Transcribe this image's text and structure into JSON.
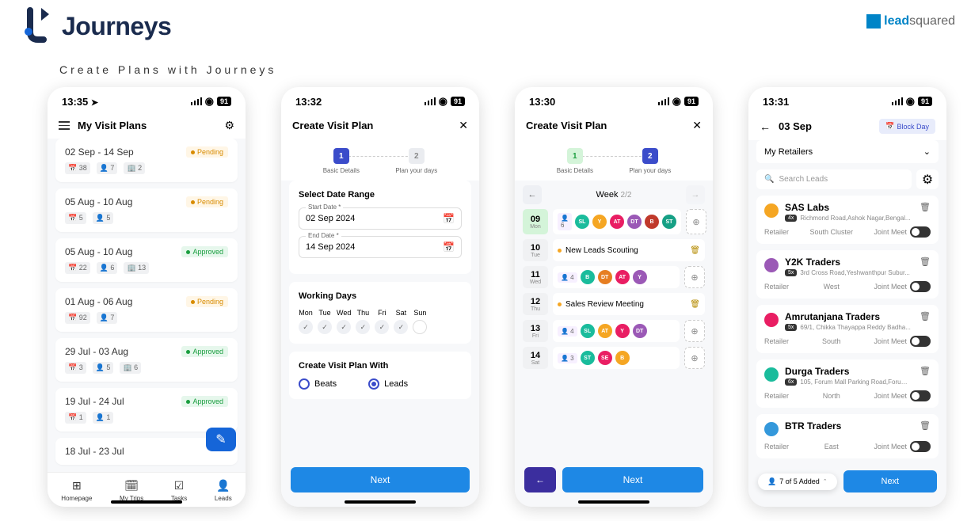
{
  "header": {
    "brand": "Journeys",
    "subtitle": "Create Plans with Journeys",
    "partner": "leadsquared"
  },
  "screen1": {
    "time": "13:35",
    "battery": "91",
    "title": "My Visit Plans",
    "plans": [
      {
        "dates": "02 Sep - 14 Sep",
        "status": "Pending",
        "s1": "38",
        "s2": "7",
        "s3": "2"
      },
      {
        "dates": "05 Aug - 10 Aug",
        "status": "Pending",
        "s1": "5",
        "s2": "5"
      },
      {
        "dates": "05 Aug - 10 Aug",
        "status": "Approved",
        "s1": "22",
        "s2": "6",
        "s3": "13"
      },
      {
        "dates": "01 Aug - 06 Aug",
        "status": "Pending",
        "s1": "92",
        "s2": "7"
      },
      {
        "dates": "29 Jul - 03 Aug",
        "status": "Approved",
        "s1": "3",
        "s2": "5",
        "s3": "6"
      },
      {
        "dates": "19 Jul - 24 Jul",
        "status": "Approved",
        "s1": "1",
        "s2": "1"
      },
      {
        "dates": "18 Jul - 23 Jul",
        "status": ""
      }
    ],
    "nav": {
      "homepage": "Homepage",
      "mytrips": "My Trips",
      "tasks": "Tasks",
      "leads": "Leads"
    }
  },
  "screen2": {
    "time": "13:32",
    "battery": "91",
    "title": "Create Visit Plan",
    "step1": "Basic Details",
    "step2": "Plan your days",
    "sec1": "Select Date Range",
    "start_label": "Start Date *",
    "start_val": "02 Sep 2024",
    "end_label": "End Date *",
    "end_val": "14 Sep 2024",
    "sec2": "Working Days",
    "days": [
      "Mon",
      "Tue",
      "Wed",
      "Thu",
      "Fri",
      "Sat",
      "Sun"
    ],
    "sec3": "Create Visit Plan With",
    "opt1": "Beats",
    "opt2": "Leads",
    "next": "Next"
  },
  "screen3": {
    "time": "13:30",
    "battery": "91",
    "title": "Create Visit Plan",
    "step1": "Basic Details",
    "step2": "Plan your days",
    "week": "Week",
    "week_sub": "2/2",
    "days": [
      {
        "num": "09",
        "name": "Mon",
        "count": "6",
        "avatars": [
          {
            "t": "SL",
            "c": "#1abc9c"
          },
          {
            "t": "Y",
            "c": "#f5a623"
          },
          {
            "t": "AT",
            "c": "#e91e63"
          },
          {
            "t": "DT",
            "c": "#9b59b6"
          },
          {
            "t": "B",
            "c": "#c0392b"
          },
          {
            "t": "ST",
            "c": "#16a085"
          }
        ]
      },
      {
        "num": "10",
        "name": "Tue",
        "event": "New Leads Scouting"
      },
      {
        "num": "11",
        "name": "Wed",
        "count": "4",
        "avatars": [
          {
            "t": "B",
            "c": "#1abc9c"
          },
          {
            "t": "DT",
            "c": "#e67e22"
          },
          {
            "t": "AT",
            "c": "#e91e63"
          },
          {
            "t": "Y",
            "c": "#9b59b6"
          }
        ]
      },
      {
        "num": "12",
        "name": "Thu",
        "event": "Sales Review Meeting"
      },
      {
        "num": "13",
        "name": "Fri",
        "count": "4",
        "avatars": [
          {
            "t": "SL",
            "c": "#1abc9c"
          },
          {
            "t": "AT",
            "c": "#f5a623"
          },
          {
            "t": "Y",
            "c": "#e91e63"
          },
          {
            "t": "DT",
            "c": "#9b59b6"
          }
        ]
      },
      {
        "num": "14",
        "name": "Sat",
        "count": "3",
        "avatars": [
          {
            "t": "ST",
            "c": "#1abc9c"
          },
          {
            "t": "SE",
            "c": "#e91e63"
          },
          {
            "t": "B",
            "c": "#f5a623"
          }
        ]
      }
    ],
    "next": "Next"
  },
  "screen4": {
    "time": "13:31",
    "battery": "91",
    "date": "03 Sep",
    "block": "Block Day",
    "dropdown": "My Retailers",
    "search_ph": "Search Leads",
    "retailers": [
      {
        "name": "SAS Labs",
        "pill": "4x",
        "addr": "Richmond Road,Ashok Nagar,Bengal...",
        "type": "Retailer",
        "cluster": "South Cluster",
        "jm": "Joint Meet",
        "c": "#f5a623"
      },
      {
        "name": "Y2K Traders",
        "pill": "5x",
        "addr": "3rd Cross Road,Yeshwanthpur Subur...",
        "type": "Retailer",
        "cluster": "West",
        "jm": "Joint Meet",
        "c": "#9b59b6"
      },
      {
        "name": "Amrutanjana Traders",
        "pill": "5x",
        "addr": "69/1, Chikka Thayappa Reddy Badha...",
        "type": "Retailer",
        "cluster": "South",
        "jm": "Joint Meet",
        "c": "#e91e63"
      },
      {
        "name": "Durga Traders",
        "pill": "6x",
        "addr": "105, Forum Mall Parking Road,Forum...",
        "type": "Retailer",
        "cluster": "North",
        "jm": "Joint Meet",
        "c": "#1abc9c"
      },
      {
        "name": "BTR Traders",
        "pill": "",
        "addr": "",
        "type": "Retailer",
        "cluster": "East",
        "jm": "Joint Meet",
        "c": "#3498db"
      }
    ],
    "added": "7 of 5 Added",
    "next": "Next"
  }
}
